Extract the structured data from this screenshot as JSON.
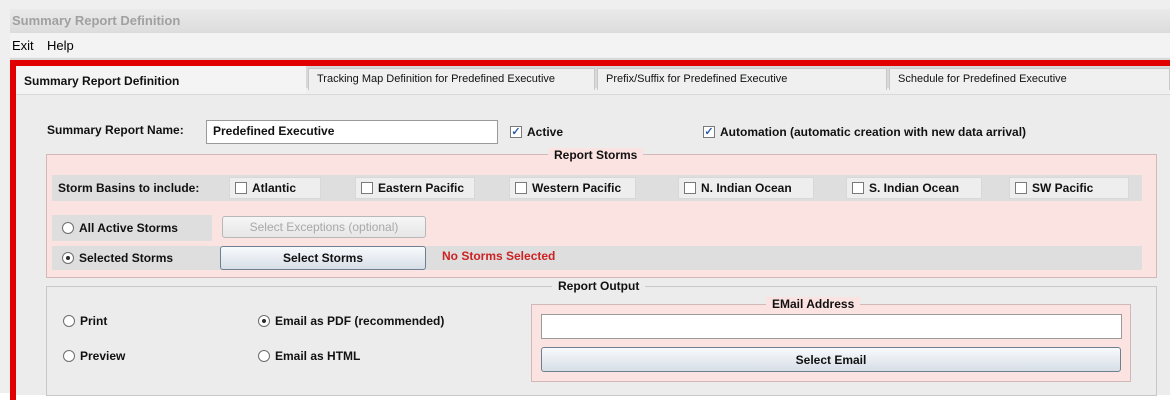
{
  "window": {
    "title": "Summary Report Definition"
  },
  "menu": {
    "exit": "Exit",
    "help": "Help"
  },
  "tabs": [
    {
      "label": "Summary Report Definition"
    },
    {
      "label": "Tracking Map Definition for Predefined Executive"
    },
    {
      "label": "Prefix/Suffix for Predefined Executive"
    },
    {
      "label": "Schedule for Predefined Executive"
    }
  ],
  "report": {
    "name_label": "Summary Report Name:",
    "name_value": "Predefined Executive",
    "active_label": "Active",
    "active_checked": true,
    "automation_label": "Automation (automatic creation with new data arrival)",
    "automation_checked": true
  },
  "storms": {
    "legend": "Report Storms",
    "basins_label": "Storm Basins to include:",
    "basins": [
      {
        "label": "Atlantic",
        "checked": false
      },
      {
        "label": "Eastern Pacific",
        "checked": false
      },
      {
        "label": "Western Pacific",
        "checked": false
      },
      {
        "label": "N. Indian Ocean",
        "checked": false
      },
      {
        "label": "S. Indian Ocean",
        "checked": false
      },
      {
        "label": "SW Pacific",
        "checked": false
      }
    ],
    "all_active_label": "All Active Storms",
    "selected_label": "Selected Storms",
    "selected_mode": "selected",
    "exceptions_button": "Select Exceptions (optional)",
    "select_storms_button": "Select Storms",
    "status": "No Storms Selected"
  },
  "output": {
    "legend": "Report Output",
    "print_label": "Print",
    "preview_label": "Preview",
    "email_pdf_label": "Email as PDF (recommended)",
    "email_html_label": "Email as HTML",
    "selected_mode": "email_pdf",
    "email": {
      "legend": "EMail Address",
      "value": "",
      "select_button": "Select Email"
    }
  },
  "colors": {
    "accent_frame": "#e00000",
    "panel_bg": "#fbe3e1",
    "status_text": "#cc2222"
  }
}
